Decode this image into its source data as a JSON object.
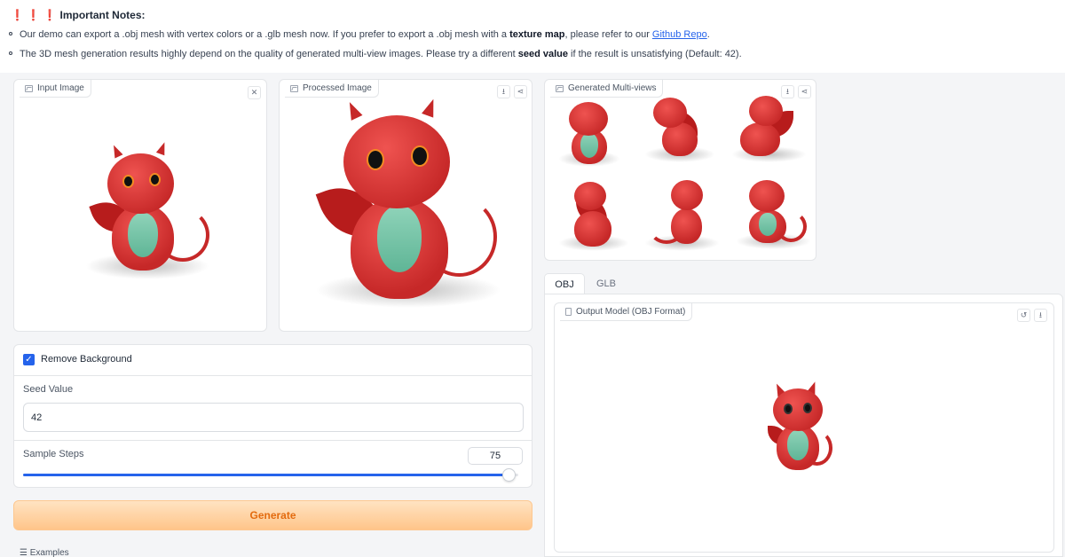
{
  "notes": {
    "bangs": "❗ ❗ ❗",
    "title": "Important Notes:",
    "line1_pre": "Our demo can export a .obj mesh with vertex colors or a .glb mesh now. If you prefer to export a .obj mesh with a ",
    "line1_bold": "texture map",
    "line1_mid": ", please refer to our ",
    "line1_link": "Github Repo",
    "line1_post": ".",
    "line2_pre": "The 3D mesh generation results highly depend on the quality of generated multi-view images. Please try a different ",
    "line2_bold": "seed value",
    "line2_post": " if the result is unsatisfying (Default: 42)."
  },
  "input_image": {
    "label": "Input Image",
    "close_icon": "close-icon"
  },
  "processed_image": {
    "label": "Processed Image",
    "download_icon": "download-icon",
    "share_icon": "share-icon"
  },
  "multiviews": {
    "label": "Generated Multi-views",
    "download_icon": "download-icon",
    "share_icon": "share-icon"
  },
  "controls": {
    "remove_bg_label": "Remove Background",
    "remove_bg_checked": true,
    "seed_label": "Seed Value",
    "seed_value": "42",
    "steps_label": "Sample Steps",
    "steps_value": "75",
    "steps_fraction": 0.98
  },
  "generate_label": "Generate",
  "examples_label": "Examples",
  "tabs": [
    {
      "label": "OBJ",
      "active": true
    },
    {
      "label": "GLB",
      "active": false
    }
  ],
  "output": {
    "label": "Output Model (OBJ Format)",
    "reset_icon": "reset-icon",
    "download_icon": "download-icon"
  },
  "colors": {
    "accent": "#2563eb",
    "generate_text": "#e36b0f",
    "notes_bang": "#e11d2e"
  }
}
